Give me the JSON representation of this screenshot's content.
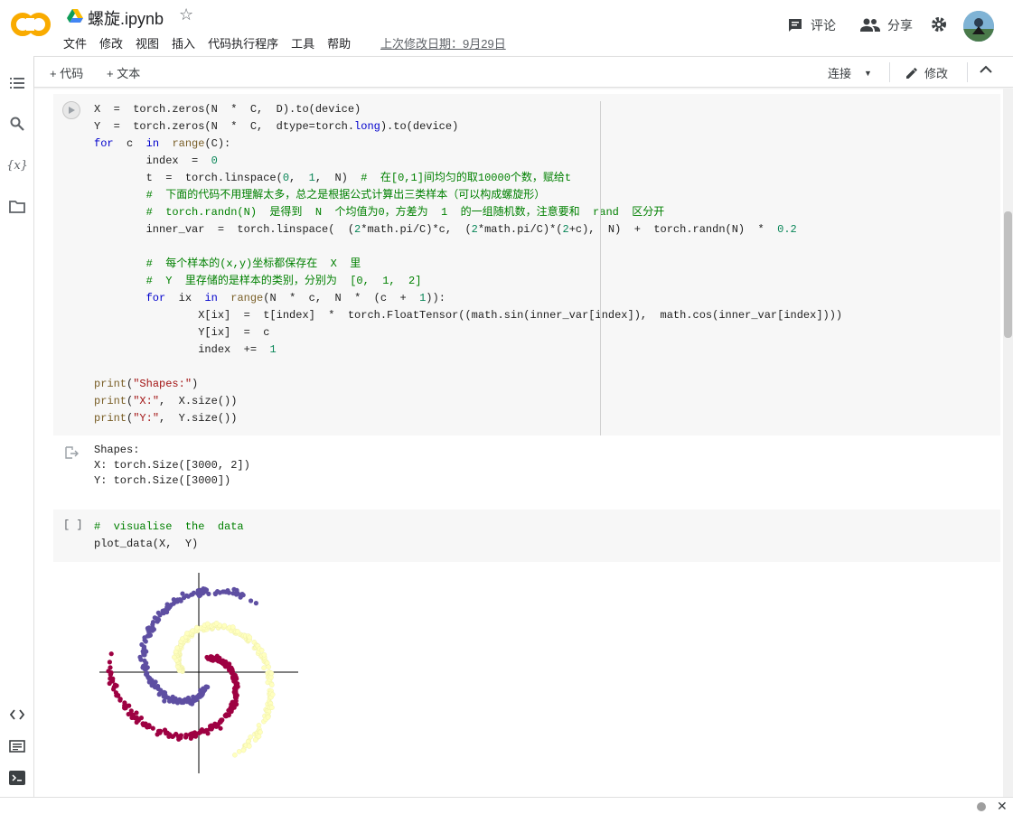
{
  "header": {
    "logo_text": "CO",
    "title": "螺旋.ipynb",
    "menu": [
      "文件",
      "修改",
      "视图",
      "插入",
      "代码执行程序",
      "工具",
      "帮助"
    ],
    "last_edit": "上次修改日期：9月29日",
    "comment_label": "评论",
    "share_label": "分享"
  },
  "toolbar": {
    "add_code": "+ 代码",
    "add_text": "+ 文本",
    "connect": "连接",
    "edit": "修改"
  },
  "cell1": {
    "code_lines": [
      "X  =  torch.zeros(N  *  C,  D).to(device)",
      "Y  =  torch.zeros(N  *  C,  dtype=torch.long).to(device)",
      "for  c  in  range(C):",
      "        index  =  0",
      "        t  =  torch.linspace(0,  1,  N)  #  在[0,1]间均匀的取10000个数，赋给t",
      "        #  下面的代码不用理解太多，总之是根据公式计算出三类样本（可以构成螺旋形）",
      "        #  torch.randn(N)  是得到  N  个均值为0，方差为  1  的一组随机数，注意要和  rand  区分开",
      "        inner_var  =  torch.linspace(  (2*math.pi/C)*c,  (2*math.pi/C)*(2+c),  N)  +  torch.randn(N)  *  0.2",
      "",
      "        #  每个样本的(x,y)坐标都保存在  X  里",
      "        #  Y  里存储的是样本的类别，分别为  [0,  1,  2]",
      "        for  ix  in  range(N  *  c,  N  *  (c  +  1)):",
      "                X[ix]  =  t[index]  *  torch.FloatTensor((math.sin(inner_var[index]),  math.cos(inner_var[index])))",
      "                Y[ix]  =  c",
      "                index  +=  1",
      "",
      "print(\"Shapes:\")",
      "print(\"X:\",  X.size())",
      "print(\"Y:\",  Y.size())"
    ],
    "output_lines": [
      "Shapes:",
      "X: torch.Size([3000, 2])",
      "Y: torch.Size([3000])"
    ]
  },
  "cell2": {
    "bracket": "[ ]",
    "code_lines": [
      "#  visualise  the  data",
      "plot_data(X,  Y)"
    ]
  },
  "plot": {
    "colors": {
      "class0": "#9e0142",
      "class1": "#5e4fa2",
      "class2": "#ffffbf"
    }
  },
  "rail_icons": [
    "toc-icon",
    "search-icon",
    "variables-icon",
    "folder-icon",
    "code-snippets-icon",
    "command-palette-icon",
    "terminal-icon"
  ]
}
